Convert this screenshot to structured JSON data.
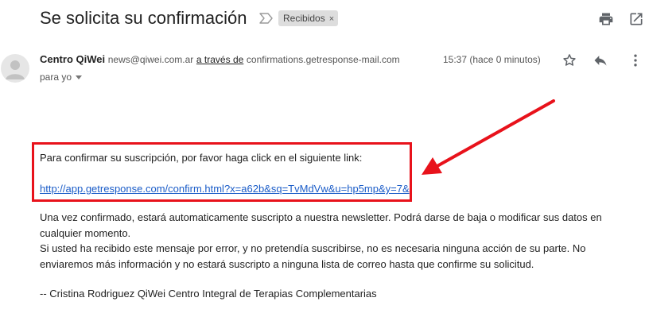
{
  "email": {
    "subject": "Se solicita su confirmación",
    "label": "Recibidos",
    "label_remove": "×",
    "sender": {
      "name": "Centro QiWei",
      "email": "news@qiwei.com.ar",
      "via_text": "a través de",
      "via_domain": "confirmations.getresponse-mail.com"
    },
    "time": "15:37 (hace 0 minutos)",
    "to": "para yo",
    "body": {
      "intro": "Para confirmar su suscripción, por favor haga click en el siguiente link:",
      "link": "http://app.getresponse.com/confirm.html?x=a62b&sq=TvMdVw&u=hp5mp&y=7&",
      "para1_line1": "Una vez confirmado, estará automaticamente suscripto a nuestra newsletter. Podrá darse de baja o modificar sus datos en",
      "para1_line2": "cualquier momento.",
      "para2_line1": "Si usted ha recibido este mensaje por error, y no pretendía suscribirse, no es necesaria ninguna acción de su parte. No",
      "para2_line2": "enviaremos más información y no estará suscripto a ninguna lista de correo hasta que confirme su solicitud.",
      "signature": "-- Cristina Rodriguez QiWei Centro Integral de Terapias Complementarias"
    }
  },
  "icons": {
    "print": "print-icon",
    "open_new": "open-in-new-window-icon",
    "star": "star-icon",
    "reply": "reply-icon",
    "more": "more-vertical-icon",
    "label_arrow": "important-marker-icon",
    "avatar": "avatar-icon"
  },
  "colors": {
    "annotation_red": "#e8121b",
    "link_blue": "#1a5cc8",
    "label_chip_bg": "#dddddd"
  }
}
